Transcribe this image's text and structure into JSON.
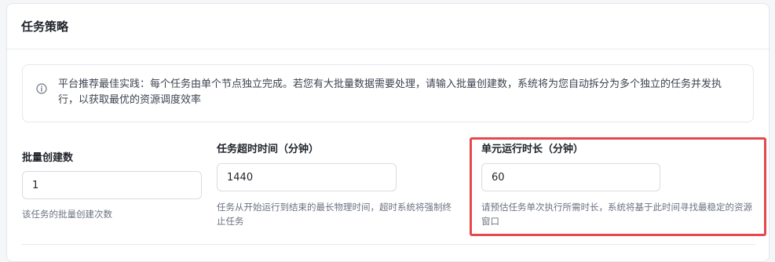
{
  "section": {
    "title": "任务策略"
  },
  "alert": {
    "icon": "info-icon",
    "text": "平台推荐最佳实践：每个任务由单个节点独立完成。若您有大批量数据需要处理，请输入批量创建数，系统将为您自动拆分为多个独立的任务并发执行，以获取最优的资源调度效率"
  },
  "fields": {
    "batch_count": {
      "label": "批量创建数",
      "value": "1",
      "help": "该任务的批量创建次数"
    },
    "timeout": {
      "label": "任务超时时间（分钟）",
      "value": "1440",
      "help": "任务从开始运行到结束的最长物理时间，超时系统将强制终止任务"
    },
    "unit_duration": {
      "label": "单元运行时长（分钟）",
      "value": "60",
      "help": "请预估任务单次执行所需时长，系统将基于此时间寻找最稳定的资源窗口"
    }
  },
  "colors": {
    "highlight": "#e5484d",
    "info_icon": "#6b7280"
  }
}
